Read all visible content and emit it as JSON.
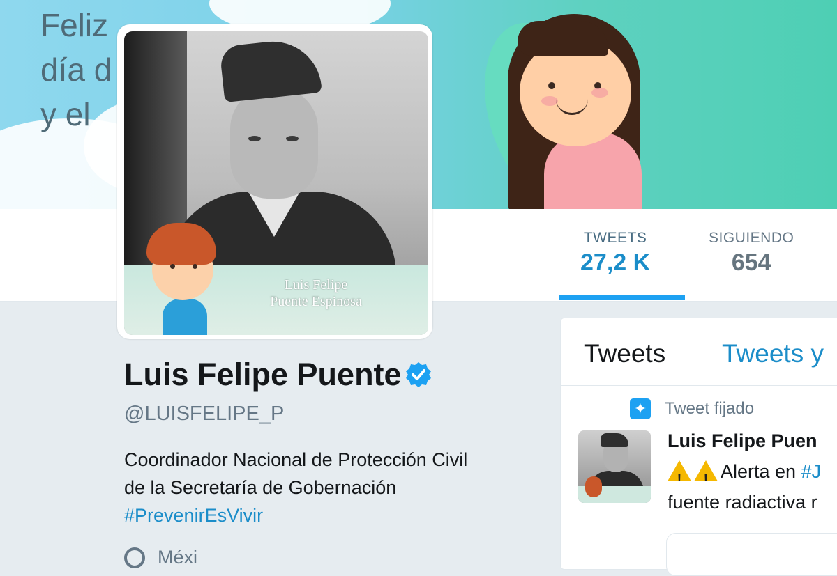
{
  "banner": {
    "text": "Feliz\ndía d\ny el"
  },
  "avatar": {
    "caption_line1": "Luis Felipe",
    "caption_line2": "Puente Espinosa"
  },
  "nav": {
    "tweets_label": "TWEETS",
    "tweets_value": "27,2 K",
    "siguiendo_label": "SIGUIENDO",
    "siguiendo_value": "654"
  },
  "profile": {
    "name": "Luis Felipe Puente",
    "handle": "@LUISFELIPE_P",
    "bio_line1": "Coordinador Nacional de Protección Civil",
    "bio_line2": "de la Secretaría de Gobernación",
    "hashtag": "#PrevenirEsVivir",
    "location": "Méxi"
  },
  "timeline": {
    "tab_tweets": "Tweets",
    "tab_tweets_replies": "Tweets y",
    "pinned_label": "Tweet fijado",
    "tweet_author": "Luis Felipe Puen",
    "tweet_line1_pre": "Alerta en ",
    "tweet_line1_hash": "#J",
    "tweet_line2": "fuente radiactiva r"
  },
  "colors": {
    "accent": "#1da1f2",
    "link": "#1b8dc9",
    "text": "#14171a",
    "muted": "#657786"
  }
}
